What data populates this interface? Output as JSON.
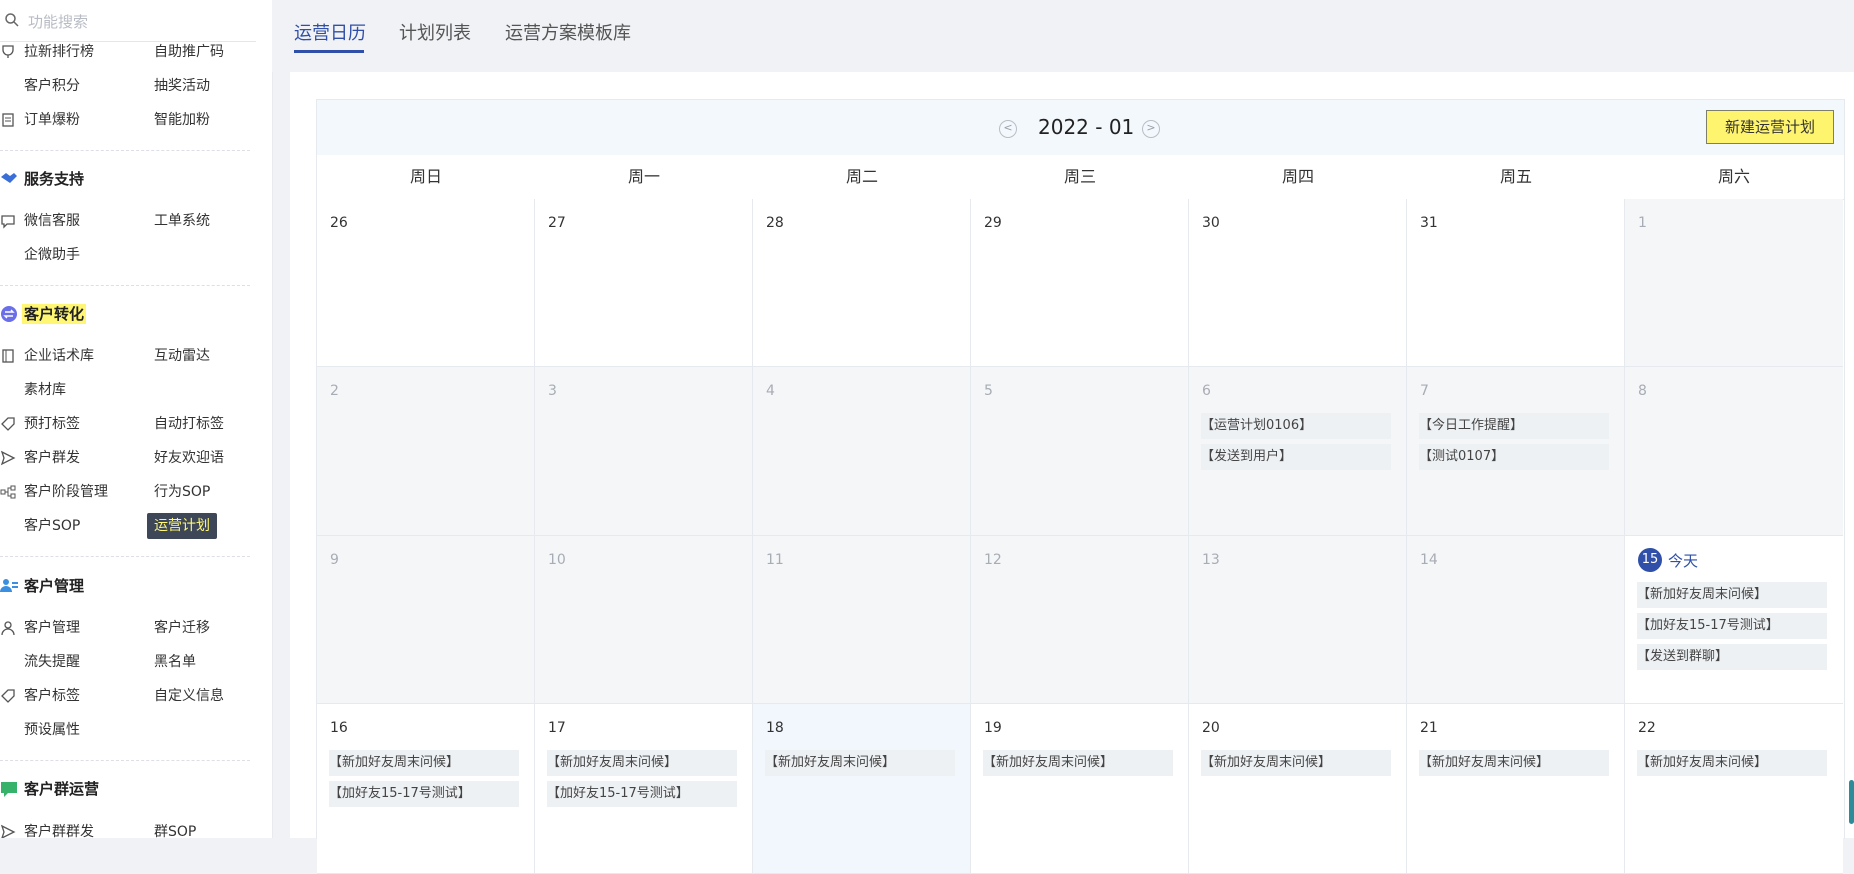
{
  "sidebar": {
    "search_placeholder": "功能搜索",
    "groups": [
      {
        "rows": [
          [
            "拉新排行榜",
            "自助推广码"
          ],
          [
            "客户积分",
            "抽奖活动"
          ],
          [
            "订单爆粉",
            "智能加粉"
          ]
        ]
      },
      {
        "title": "服务支持",
        "rows": [
          [
            "微信客服",
            "工单系统"
          ],
          [
            "企微助手",
            ""
          ]
        ]
      },
      {
        "title": "客户转化",
        "rows": [
          [
            "企业话术库",
            "互动雷达"
          ],
          [
            "素材库",
            ""
          ],
          [
            "预打标签",
            "自动打标签"
          ],
          [
            "客户群发",
            "好友欢迎语"
          ],
          [
            "客户阶段管理",
            "行为SOP"
          ],
          [
            "客户SOP",
            "运营计划"
          ]
        ]
      },
      {
        "title": "客户管理",
        "rows": [
          [
            "客户管理",
            "客户迁移"
          ],
          [
            "流失提醒",
            "黑名单"
          ],
          [
            "客户标签",
            "自定义信息"
          ],
          [
            "预设属性",
            ""
          ]
        ]
      },
      {
        "title": "客户群运营",
        "rows": [
          [
            "客户群群发",
            "群SOP"
          ]
        ]
      }
    ]
  },
  "tabs": [
    "运营日历",
    "计划列表",
    "运营方案模板库"
  ],
  "calendar": {
    "month": "2022 - 01",
    "new_button": "新建运营计划",
    "weekdays": [
      "周日",
      "周一",
      "周二",
      "周三",
      "周四",
      "周五",
      "周六"
    ],
    "today_label": "今天",
    "weeks": [
      [
        {
          "d": "26"
        },
        {
          "d": "27"
        },
        {
          "d": "28"
        },
        {
          "d": "29"
        },
        {
          "d": "30"
        },
        {
          "d": "31"
        },
        {
          "d": "1"
        }
      ],
      [
        {
          "d": "2"
        },
        {
          "d": "3"
        },
        {
          "d": "4"
        },
        {
          "d": "5"
        },
        {
          "d": "6",
          "events": [
            "【运营计划0106】",
            "【发送到用户】"
          ]
        },
        {
          "d": "7",
          "events": [
            "【今日工作提醒】",
            "【测试0107】"
          ]
        },
        {
          "d": "8"
        }
      ],
      [
        {
          "d": "9"
        },
        {
          "d": "10"
        },
        {
          "d": "11"
        },
        {
          "d": "12"
        },
        {
          "d": "13"
        },
        {
          "d": "14"
        },
        {
          "d": "15",
          "today": true,
          "events": [
            "【新加好友周末问候】",
            "【加好友15-17号测试】",
            "【发送到群聊】"
          ]
        }
      ],
      [
        {
          "d": "16",
          "events": [
            "【新加好友周末问候】",
            "【加好友15-17号测试】"
          ]
        },
        {
          "d": "17",
          "events": [
            "【新加好友周末问候】",
            "【加好友15-17号测试】"
          ]
        },
        {
          "d": "18",
          "events": [
            "【新加好友周末问候】"
          ]
        },
        {
          "d": "19",
          "events": [
            "【新加好友周末问候】"
          ]
        },
        {
          "d": "20",
          "events": [
            "【新加好友周末问候】"
          ]
        },
        {
          "d": "21",
          "events": [
            "【新加好友周末问候】"
          ]
        },
        {
          "d": "22",
          "events": [
            "【新加好友周末问候】"
          ]
        }
      ]
    ]
  }
}
